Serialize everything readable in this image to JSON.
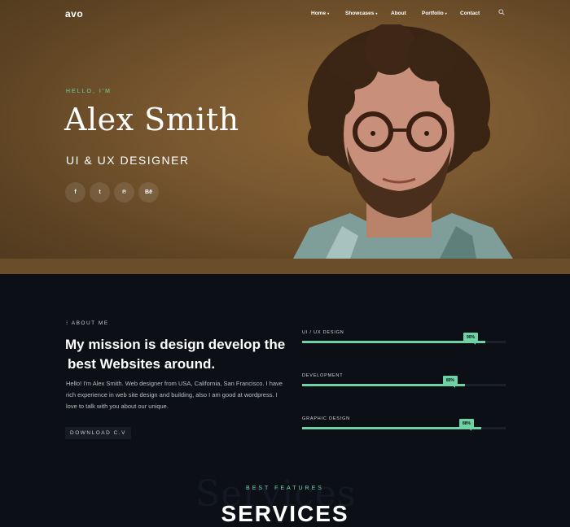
{
  "nav": {
    "logo": "avo",
    "items": [
      {
        "label": "Home",
        "caret": true
      },
      {
        "label": "Showcases",
        "caret": true
      },
      {
        "label": "About",
        "caret": false
      },
      {
        "label": "Portfolio",
        "caret": true
      },
      {
        "label": "Contact",
        "caret": false
      }
    ],
    "caret_glyph": "▾"
  },
  "hero": {
    "greeting": "HELLO, I'M",
    "name": "Alex Smith",
    "role": "UI & UX DESIGNER",
    "socials": [
      {
        "icon": "facebook-icon",
        "glyph": "f"
      },
      {
        "icon": "twitter-icon",
        "glyph": "t"
      },
      {
        "icon": "pinterest-icon",
        "glyph": "℗"
      },
      {
        "icon": "behance-icon",
        "glyph": "Bē"
      }
    ]
  },
  "about": {
    "label": "ABOUT ME",
    "mission_line1": "My mission is design develop the",
    "mission_line2": "best Websites around.",
    "bio": "Hello! I'm Alex Smith. Web designer from USA, California, San Francisco. I have rich experience in web site design and building, also I am good at wordpress. I love to talk with you about our unique.",
    "download_label": "DOWNLOAD C.V"
  },
  "skills": [
    {
      "label": "UI / UX DESIGN",
      "percent": 90,
      "badge": "90%"
    },
    {
      "label": "DEVELOPMENT",
      "percent": 80,
      "badge": "80%"
    },
    {
      "label": "GRAPHIC DESIGN",
      "percent": 88,
      "badge": "88%"
    }
  ],
  "services": {
    "watermark": "Services",
    "eyebrow": "BEST FEATURES",
    "title": "SERVICES"
  },
  "colors": {
    "accent": "#6ed2a4",
    "dark_bg": "#0c0f16",
    "hero_brown": "#7a5830"
  }
}
